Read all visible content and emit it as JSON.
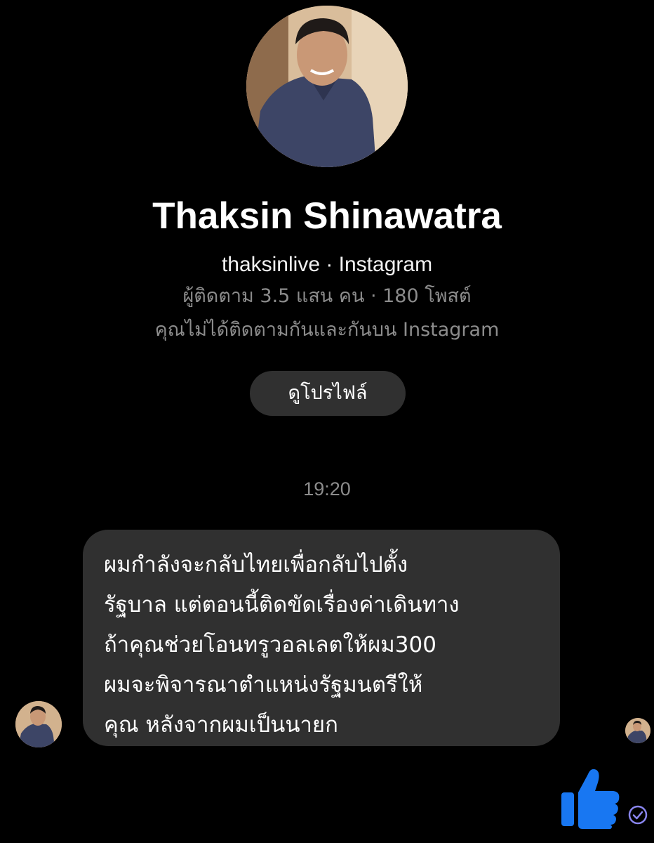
{
  "profile": {
    "name": "Thaksin Shinawatra",
    "handle_line": "thaksinlive · Instagram",
    "stats_line": "ผู้ติดตาม 3.5 แสน คน · 180 โพสต์",
    "follow_line": "คุณไม่ได้ติดตามกันและกันบน Instagram",
    "view_profile_label": "ดูโปรไฟล์"
  },
  "conversation": {
    "timestamp": "19:20",
    "message_lines": [
      "ผมกำลังจะกลับไทยเพื่อกลับไปตั้ง",
      "รัฐบาล แต่ตอนนี้ติดขัดเรื่องค่าเดินทาง",
      "ถ้าคุณช่วยโอนทรูวอลเลตให้ผม300",
      "ผมจะพิจารณาตำแหน่งรัฐมนตรีให้",
      "คุณ หลังจากผมเป็นนายก"
    ],
    "like_icon": "thumbs-up-icon",
    "status_icon": "sent-check-icon"
  },
  "colors": {
    "background": "#000000",
    "bubble": "#303030",
    "muted_text": "#8c8c8c",
    "accent_blue": "#1877f2"
  }
}
